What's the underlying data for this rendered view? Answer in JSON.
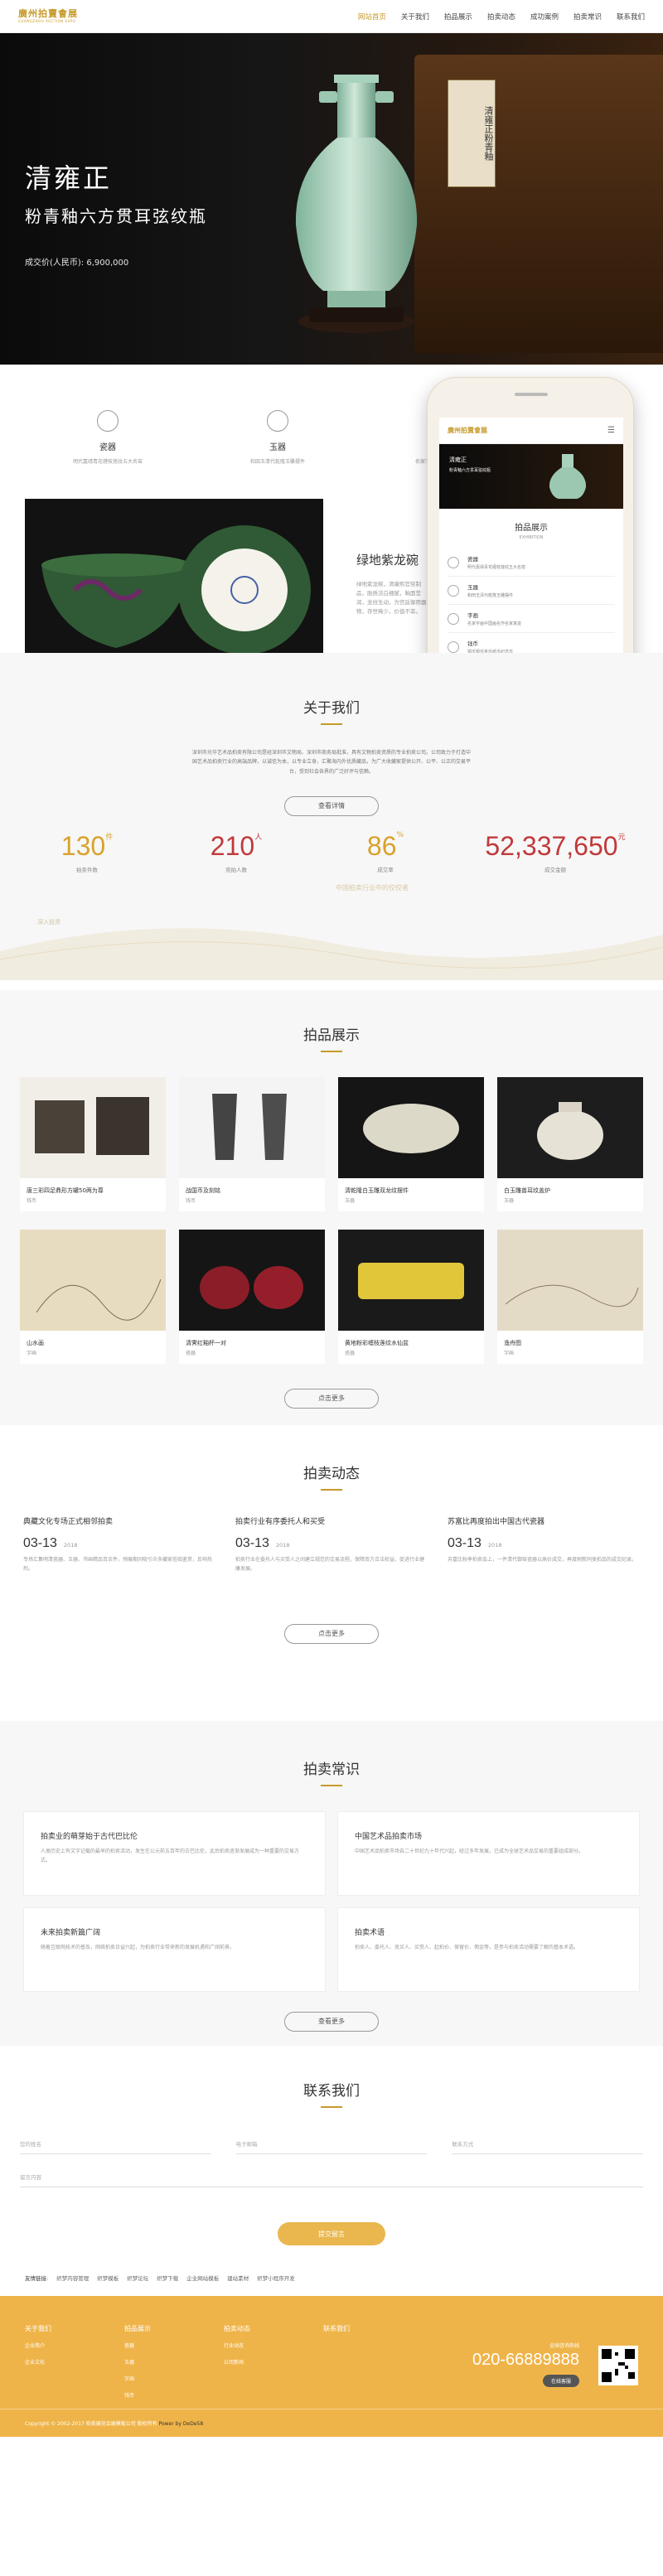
{
  "header": {
    "logo_cn": "廣州拍賣會展",
    "logo_en": "GUANGZHOU AUCTION EXPO",
    "nav": [
      "网站首页",
      "关于我们",
      "拍品展示",
      "拍卖动态",
      "成功案例",
      "拍卖常识",
      "联系我们"
    ]
  },
  "hero": {
    "title": "清雍正",
    "subtitle": "粉青釉六方贯耳弦纹瓶",
    "price": "成交价(人民币): 6,900,000",
    "box_label": "清雍正粉青釉"
  },
  "categories": [
    {
      "title": "瓷器",
      "desc": "明代嘉靖青花缠枝莲纹五大名窑",
      "icon": "vase-icon"
    },
    {
      "title": "玉器",
      "desc": "和田玉清代乾隆玉雕摆件",
      "icon": "jade-icon"
    },
    {
      "title": "字画",
      "desc": "名家字画中国画名作名家真迹",
      "icon": "scroll-icon"
    }
  ],
  "featured": {
    "title": "绿地紫龙碗",
    "desc": "绿地紫龙碗，清康熙官窑制品，胎质洁白细腻，釉面莹润，龙纹生动，为宫廷御用器物，存世稀少，价值不菲。"
  },
  "phone_screen": {
    "logo_cn": "廣州拍賣會展",
    "logo_en": "GUANGZHOU AUCTION EXPO",
    "banner_t1": "清雍正",
    "banner_t2": "粉青釉六方贯耳弦纹瓶",
    "section": "拍品展示",
    "section_en": "EXHIBITION",
    "items": [
      {
        "t": "瓷器",
        "d": "明代嘉靖青花缠枝莲纹五大名窑"
      },
      {
        "t": "玉器",
        "d": "和田玉清代乾隆玉雕摆件"
      },
      {
        "t": "字画",
        "d": "名家字画中国画名作名家真迹"
      },
      {
        "t": "钱币",
        "d": "铜币银币金币纸币纪念币"
      }
    ]
  },
  "about": {
    "title": "关于我们",
    "intro": "深圳市光华艺术品拍卖有限公司是经深圳市文物局、深圳市商务局批准，具有文物拍卖资质的专业拍卖公司。公司致力于打造中国艺术品拍卖行业的高端品牌，以诚信为本，以专业立身，汇聚海内外优质藏品，为广大收藏家提供公开、公平、公正的交易平台，受到社会各界的广泛好评与信赖。",
    "button": "查看详情",
    "stats": [
      {
        "value": "130",
        "unit": "件",
        "label": "拍卖件数"
      },
      {
        "value": "210",
        "unit": "人",
        "label": "竞拍人数"
      },
      {
        "value": "86",
        "unit": "%",
        "label": "成交率"
      },
      {
        "value": "52,337,650",
        "unit": "元",
        "label": "成交金额"
      }
    ],
    "wave_text1": "深入投资",
    "wave_text2": "中国拍卖行业中的佼佼者"
  },
  "products": {
    "title": "拍品展示",
    "items": [
      {
        "name": "唐三彩四足鼎形方罐50两为尊",
        "cat": "钱币"
      },
      {
        "name": "战国币及刻铭",
        "cat": "钱币"
      },
      {
        "name": "清乾隆白玉雕双龙纹摆件",
        "cat": "玉器"
      },
      {
        "name": "白玉雕兽耳纹盖炉",
        "cat": "玉器"
      },
      {
        "name": "山水画",
        "cat": "字画"
      },
      {
        "name": "清霁红釉杯一对",
        "cat": "瓷器"
      },
      {
        "name": "黄地粉彩缠枝莲纹水仙盆",
        "cat": "瓷器"
      },
      {
        "name": "渔舟图",
        "cat": "字画"
      }
    ],
    "button": "点击更多"
  },
  "news": {
    "title": "拍卖动态",
    "items": [
      {
        "t": "典藏文化专场正式相邻拍卖",
        "md": "03-13",
        "y": "2018",
        "d": "专场汇集明清瓷器、玉器、书画精品百余件，预展期间吸引众多藏家莅临鉴赏，反响热烈。"
      },
      {
        "t": "拍卖行业有序委托人和买受",
        "md": "03-13",
        "y": "2018",
        "d": "拍卖行业在委托人与买受人之间建立规范的交易流程，保障双方合法权益，促进行业健康发展。"
      },
      {
        "t": "苏富比再度拍出中国古代瓷器",
        "md": "03-13",
        "y": "2018",
        "d": "苏富比秋季拍卖会上，一件清代御窑瓷器以高价成交，再度刷新同类拍品的成交纪录。"
      }
    ],
    "button": "点击更多"
  },
  "knowledge": {
    "title": "拍卖常识",
    "items": [
      {
        "t": "拍卖业的萌芽始于古代巴比伦",
        "d": "人类历史上有文字记载的最早的拍卖活动，发生在公元前五百年的古巴比伦，此后拍卖逐渐发展成为一种重要的交易方式。"
      },
      {
        "t": "中国艺术品拍卖市场",
        "d": "中国艺术品拍卖市场自二十世纪九十年代兴起，经过多年发展，已成为全球艺术品交易的重要组成部分。"
      },
      {
        "t": "未来拍卖新篇广阔",
        "d": "随着互联网技术的普及，网络拍卖日益兴起，为拍卖行业带来新的发展机遇和广阔前景。"
      },
      {
        "t": "拍卖术语",
        "d": "拍卖人、委托人、竞买人、买受人、起拍价、保留价、佣金等，是参与拍卖活动需要了解的基本术语。"
      }
    ],
    "button": "查看更多"
  },
  "contact": {
    "title": "联系我们",
    "name_ph": "您的姓名",
    "phone_ph": "电子邮箱",
    "email_ph": "联系方式",
    "msg_ph": "留言内容",
    "submit": "提交留言"
  },
  "links": {
    "label": "友情链接:",
    "items": [
      "织梦内容管理",
      "织梦模板",
      "织梦论坛",
      "织梦下载",
      "企业网站模板",
      "建站素材",
      "织梦小程序开发"
    ]
  },
  "footer": {
    "cols": [
      {
        "h": "关于我们",
        "items": [
          "企业简介",
          "企业文化"
        ]
      },
      {
        "h": "拍品展示",
        "items": [
          "瓷器",
          "玉器",
          "字画",
          "钱币"
        ]
      },
      {
        "h": "拍卖动态",
        "items": [
          "行业动态",
          "公司新闻"
        ]
      },
      {
        "h": "联系我们",
        "items": []
      }
    ],
    "phone_label": "全国咨询热线",
    "phone": "020-66889888",
    "online": "在线客服",
    "copyright": "Copyright © 2002-2017 拍卖展览会展模板公司 版权所有",
    "powered": "Power by DeDe58"
  },
  "colors": {
    "accent": "#c79a2a",
    "footer": "#efb449",
    "red": "#c0393a"
  }
}
